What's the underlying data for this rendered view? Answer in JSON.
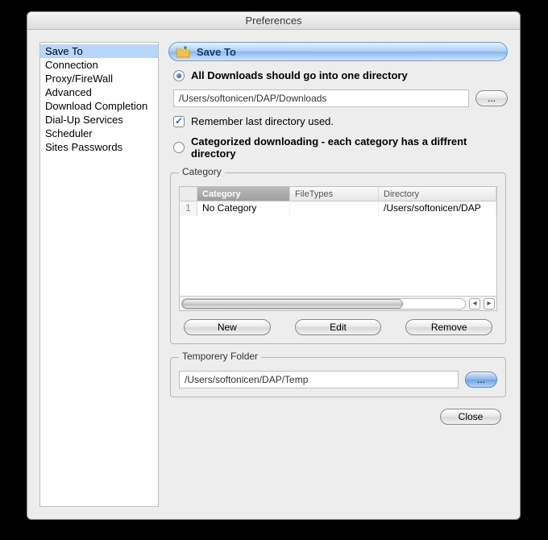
{
  "window": {
    "title": "Preferences"
  },
  "sidebar": {
    "items": [
      {
        "label": "Save To",
        "selected": true
      },
      {
        "label": "Connection",
        "selected": false
      },
      {
        "label": "Proxy/FireWall",
        "selected": false
      },
      {
        "label": "Advanced",
        "selected": false
      },
      {
        "label": "Download Completion",
        "selected": false
      },
      {
        "label": "Dial-Up Services",
        "selected": false
      },
      {
        "label": "Scheduler",
        "selected": false
      },
      {
        "label": "Sites Passwords",
        "selected": false
      }
    ]
  },
  "section": {
    "title": "Save To"
  },
  "options": {
    "single_dir_label": "All Downloads should go into one directory",
    "single_dir_selected": true,
    "download_path": "/Users/softonicen/DAP/Downloads",
    "browse_label": "...",
    "remember_label": "Remember last directory used.",
    "remember_checked": true,
    "categorized_label": "Categorized downloading - each category has a diffrent directory",
    "categorized_selected": false
  },
  "category_group": {
    "legend": "Category",
    "columns": {
      "num": "",
      "category": "Category",
      "filetypes": "FileTypes",
      "directory": "Directory"
    },
    "rows": [
      {
        "num": "1",
        "category": "No Category",
        "filetypes": "",
        "directory": "/Users/softonicen/DAP"
      }
    ],
    "buttons": {
      "new": "New",
      "edit": "Edit",
      "remove": "Remove"
    }
  },
  "temp_group": {
    "legend": "Temporery Folder",
    "path": "/Users/softonicen/DAP/Temp",
    "browse_label": "..."
  },
  "footer": {
    "close": "Close"
  }
}
